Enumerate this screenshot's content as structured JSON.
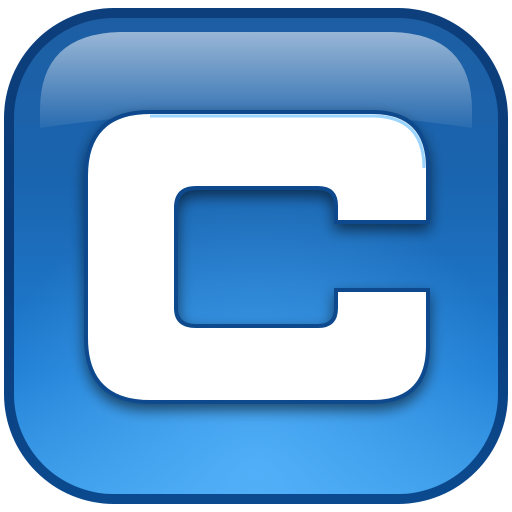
{
  "icon": {
    "name": "letter-c-icon",
    "glyph": "C",
    "colors": {
      "outer_rim": "#0a3a78",
      "body_top": "#2f7fc4",
      "body_bottom": "#1f78cf",
      "inner_fill": "#2a8ad8",
      "letter_fill": "#ffffff",
      "letter_stroke": "#0b4a8c"
    }
  }
}
